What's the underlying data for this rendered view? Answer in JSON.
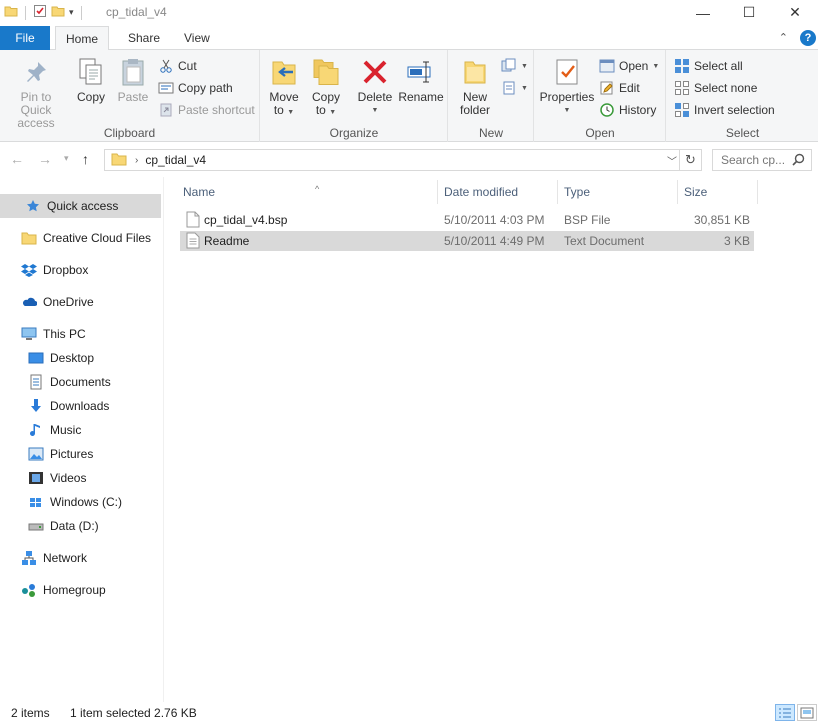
{
  "window": {
    "title": "cp_tidal_v4",
    "minimize": "—",
    "maximize": "☐",
    "close": "✕"
  },
  "tabs": {
    "file": "File",
    "home": "Home",
    "share": "Share",
    "view": "View",
    "help": "?"
  },
  "ribbon": {
    "clipboard": {
      "label": "Clipboard",
      "pin_line1": "Pin to Quick",
      "pin_line2": "access",
      "copy": "Copy",
      "paste": "Paste",
      "cut": "Cut",
      "copy_path": "Copy path",
      "paste_shortcut": "Paste shortcut"
    },
    "organize": {
      "label": "Organize",
      "move_line1": "Move",
      "move_line2": "to",
      "copy_line1": "Copy",
      "copy_line2": "to",
      "delete": "Delete",
      "rename": "Rename"
    },
    "new": {
      "label": "New",
      "folder_line1": "New",
      "folder_line2": "folder"
    },
    "open": {
      "label": "Open",
      "properties": "Properties",
      "open": "Open",
      "edit": "Edit",
      "history": "History"
    },
    "select": {
      "label": "Select",
      "select_all": "Select all",
      "select_none": "Select none",
      "invert": "Invert selection"
    }
  },
  "address": {
    "crumb": "cp_tidal_v4",
    "search_placeholder": "Search cp..."
  },
  "navpane": {
    "items": [
      {
        "label": "Quick access"
      },
      {
        "label": "Creative Cloud Files"
      },
      {
        "label": "Dropbox"
      },
      {
        "label": "OneDrive"
      },
      {
        "label": "This PC"
      },
      {
        "label": "Desktop"
      },
      {
        "label": "Documents"
      },
      {
        "label": "Downloads"
      },
      {
        "label": "Music"
      },
      {
        "label": "Pictures"
      },
      {
        "label": "Videos"
      },
      {
        "label": "Windows (C:)"
      },
      {
        "label": "Data (D:)"
      },
      {
        "label": "Network"
      },
      {
        "label": "Homegroup"
      }
    ]
  },
  "files": {
    "columns": {
      "name": "Name",
      "date": "Date modified",
      "type": "Type",
      "size": "Size"
    },
    "rows": [
      {
        "name": "cp_tidal_v4.bsp",
        "date": "5/10/2011 4:03 PM",
        "type": "BSP File",
        "size": "30,851 KB"
      },
      {
        "name": "Readme",
        "date": "5/10/2011 4:49 PM",
        "type": "Text Document",
        "size": "3 KB"
      }
    ]
  },
  "status": {
    "count": "2 items",
    "selection": "1 item selected  2.76 KB"
  },
  "colors": {
    "accent": "#1979ca",
    "selected_row": "#d9d9d9",
    "folder": "#f8d775"
  }
}
